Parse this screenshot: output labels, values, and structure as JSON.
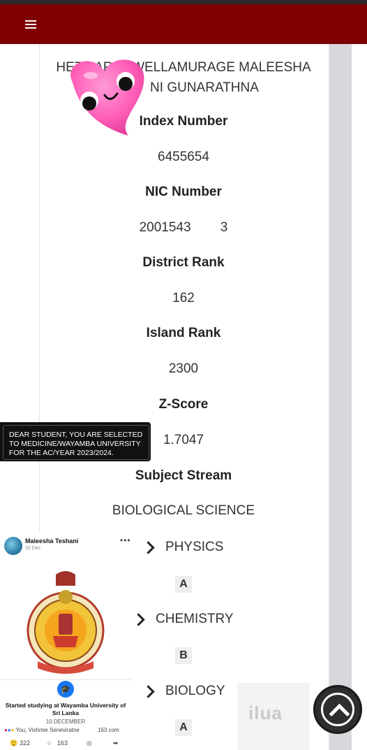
{
  "student": {
    "name_line1": "HETTIARA        I WELLAMURAGE MALEESHA",
    "name_line2": "NI GUNARATHNA"
  },
  "fields": {
    "index_label": "Index Number",
    "index_value": "6455654",
    "nic_label": "NIC Number",
    "nic_value": "2001543        3",
    "district_label": "District Rank",
    "district_value": "162",
    "island_label": "Island Rank",
    "island_value": "2300",
    "zscore_label": "Z-Score",
    "zscore_value": "1.7047",
    "stream_label": "Subject Stream",
    "stream_value": "BIOLOGICAL SCIENCE"
  },
  "subjects": [
    {
      "name": "PHYSICS",
      "grade": "A"
    },
    {
      "name": "CHEMISTRY",
      "grade": "B"
    },
    {
      "name": "BIOLOGY",
      "grade": "A"
    }
  ],
  "banner": {
    "text": "DEAR STUDENT, YOU ARE SELECTED TO MEDICINE/WAYAMBA UNIVERSITY FOR THE AC/YEAR 2023/2024."
  },
  "fbpost": {
    "author": "Maleesha Teshani",
    "time": "10 Dec",
    "title": "Started studying at Wayamba University of Sri Lanka",
    "date": "10 DECEMBER",
    "reactors": "You, Vishmie Seneviratne",
    "comments_short": "163 com",
    "likes": "322",
    "comments": "163"
  },
  "watermark": {
    "text": "ilua"
  },
  "colors": {
    "navbar": "#7f0000",
    "heart": "#ff5fb8",
    "fb_blue": "#1877f2"
  }
}
